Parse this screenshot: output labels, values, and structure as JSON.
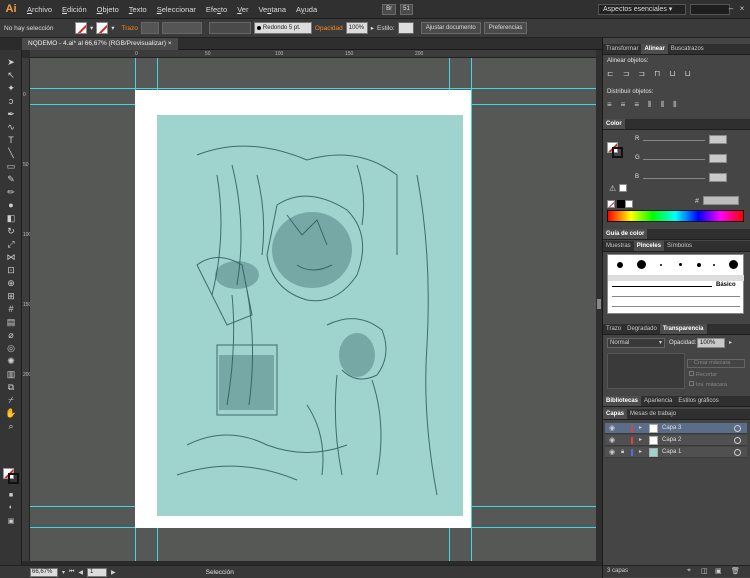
{
  "app": {
    "logo": "Ai",
    "workspace": "Aspectos esenciales",
    "workspace_arrow": "▾",
    "arrange_icon_label": "51"
  },
  "menus": [
    "Archivo",
    "Edición",
    "Objeto",
    "Texto",
    "Seleccionar",
    "Efecto",
    "Ver",
    "Ventana",
    "Ayuda"
  ],
  "control": {
    "selection": "No hay selección",
    "stroke_label": "Trazo",
    "brush": "Redondo 5 pt.",
    "opacity_label": "Opacidad",
    "opacity_value": "100%",
    "style_label": "Estilo:",
    "fit_document": "Ajustar documento",
    "preferences": "Preferencias"
  },
  "document": {
    "tab": "NQDEMO - 4.ai* al 66,67% (RGB/Previsualizar)",
    "close": "×"
  },
  "rulers": {
    "top": [
      "0",
      "50",
      "100",
      "150",
      "200"
    ],
    "left": [
      "0",
      "50",
      "100",
      "150",
      "200"
    ]
  },
  "status": {
    "zoom": "66,67%",
    "page": "1",
    "tool": "Selección"
  },
  "panel_align": {
    "tabs": [
      "Transformar",
      "Alinear",
      "Buscatrazos"
    ],
    "active": "Alinear",
    "align_objects": "Alinear objetos:",
    "distribute_objects": "Distribuir objetos:"
  },
  "panel_color": {
    "tab": "Color",
    "channels": [
      "R",
      "G",
      "B"
    ]
  },
  "panel_guide": {
    "tab": "Guía de color"
  },
  "panel_brushes": {
    "tabs": [
      "Muestras",
      "Pinceles",
      "Símbolos"
    ],
    "active": "Pinceles",
    "basic_label": "Básico"
  },
  "panel_transparency": {
    "tabs": [
      "Trazo",
      "Degradado",
      "Transparencia"
    ],
    "active": "Transparencia",
    "blend_mode": "Normal",
    "opacity_label": "Opacidad:",
    "opacity_value": "100%",
    "make_mask": "Crear máscara",
    "clip": "Recortar",
    "invert_mask": "Inv. máscara"
  },
  "panel_libs": {
    "tabs": [
      "Bibliotecas",
      "Apariencia",
      "Estilos gráficos"
    ],
    "active": "Bibliotecas"
  },
  "panel_layers": {
    "tabs": [
      "Capas",
      "Mesas de trabajo"
    ],
    "active": "Capas",
    "layers": [
      {
        "name": "Capa 3",
        "color": "#e04040",
        "selected": true
      },
      {
        "name": "Capa 2",
        "color": "#e04040",
        "selected": false
      },
      {
        "name": "Capa 1",
        "color": "#4a72d8",
        "selected": false
      }
    ],
    "count": "3 capas"
  }
}
